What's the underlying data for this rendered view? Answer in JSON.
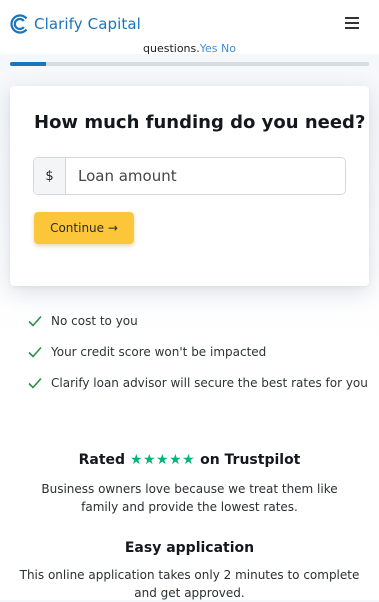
{
  "header": {
    "brand": "Clarify Capital",
    "menu_icon": "hamburger-menu-icon",
    "logo_icon": "clarify-logo-icon",
    "brand_color": "#1b75bb"
  },
  "previous_question": {
    "text": "questions.",
    "yes_label": "Yes",
    "no_label": "No"
  },
  "progress": {
    "fraction": 0.1
  },
  "form": {
    "title": "How much funding do you need?",
    "currency_symbol": "$",
    "amount_placeholder": "Loan amount",
    "amount_value": "",
    "continue_label": "Continue →",
    "button_color": "#fcc63a"
  },
  "benefits": [
    "No cost to you",
    "Your credit score won't be impacted",
    "Clarify loan advisor will secure the best rates for you"
  ],
  "trustpilot": {
    "rated_prefix": "Rated",
    "stars": "★★★★★",
    "rated_suffix": "on Trustpilot",
    "star_color": "#00b67a",
    "description": "Business owners love because we treat them like family and provide the lowest rates."
  },
  "easy_application": {
    "title": "Easy application",
    "description": "This online application takes only 2 minutes to complete and get approved."
  }
}
